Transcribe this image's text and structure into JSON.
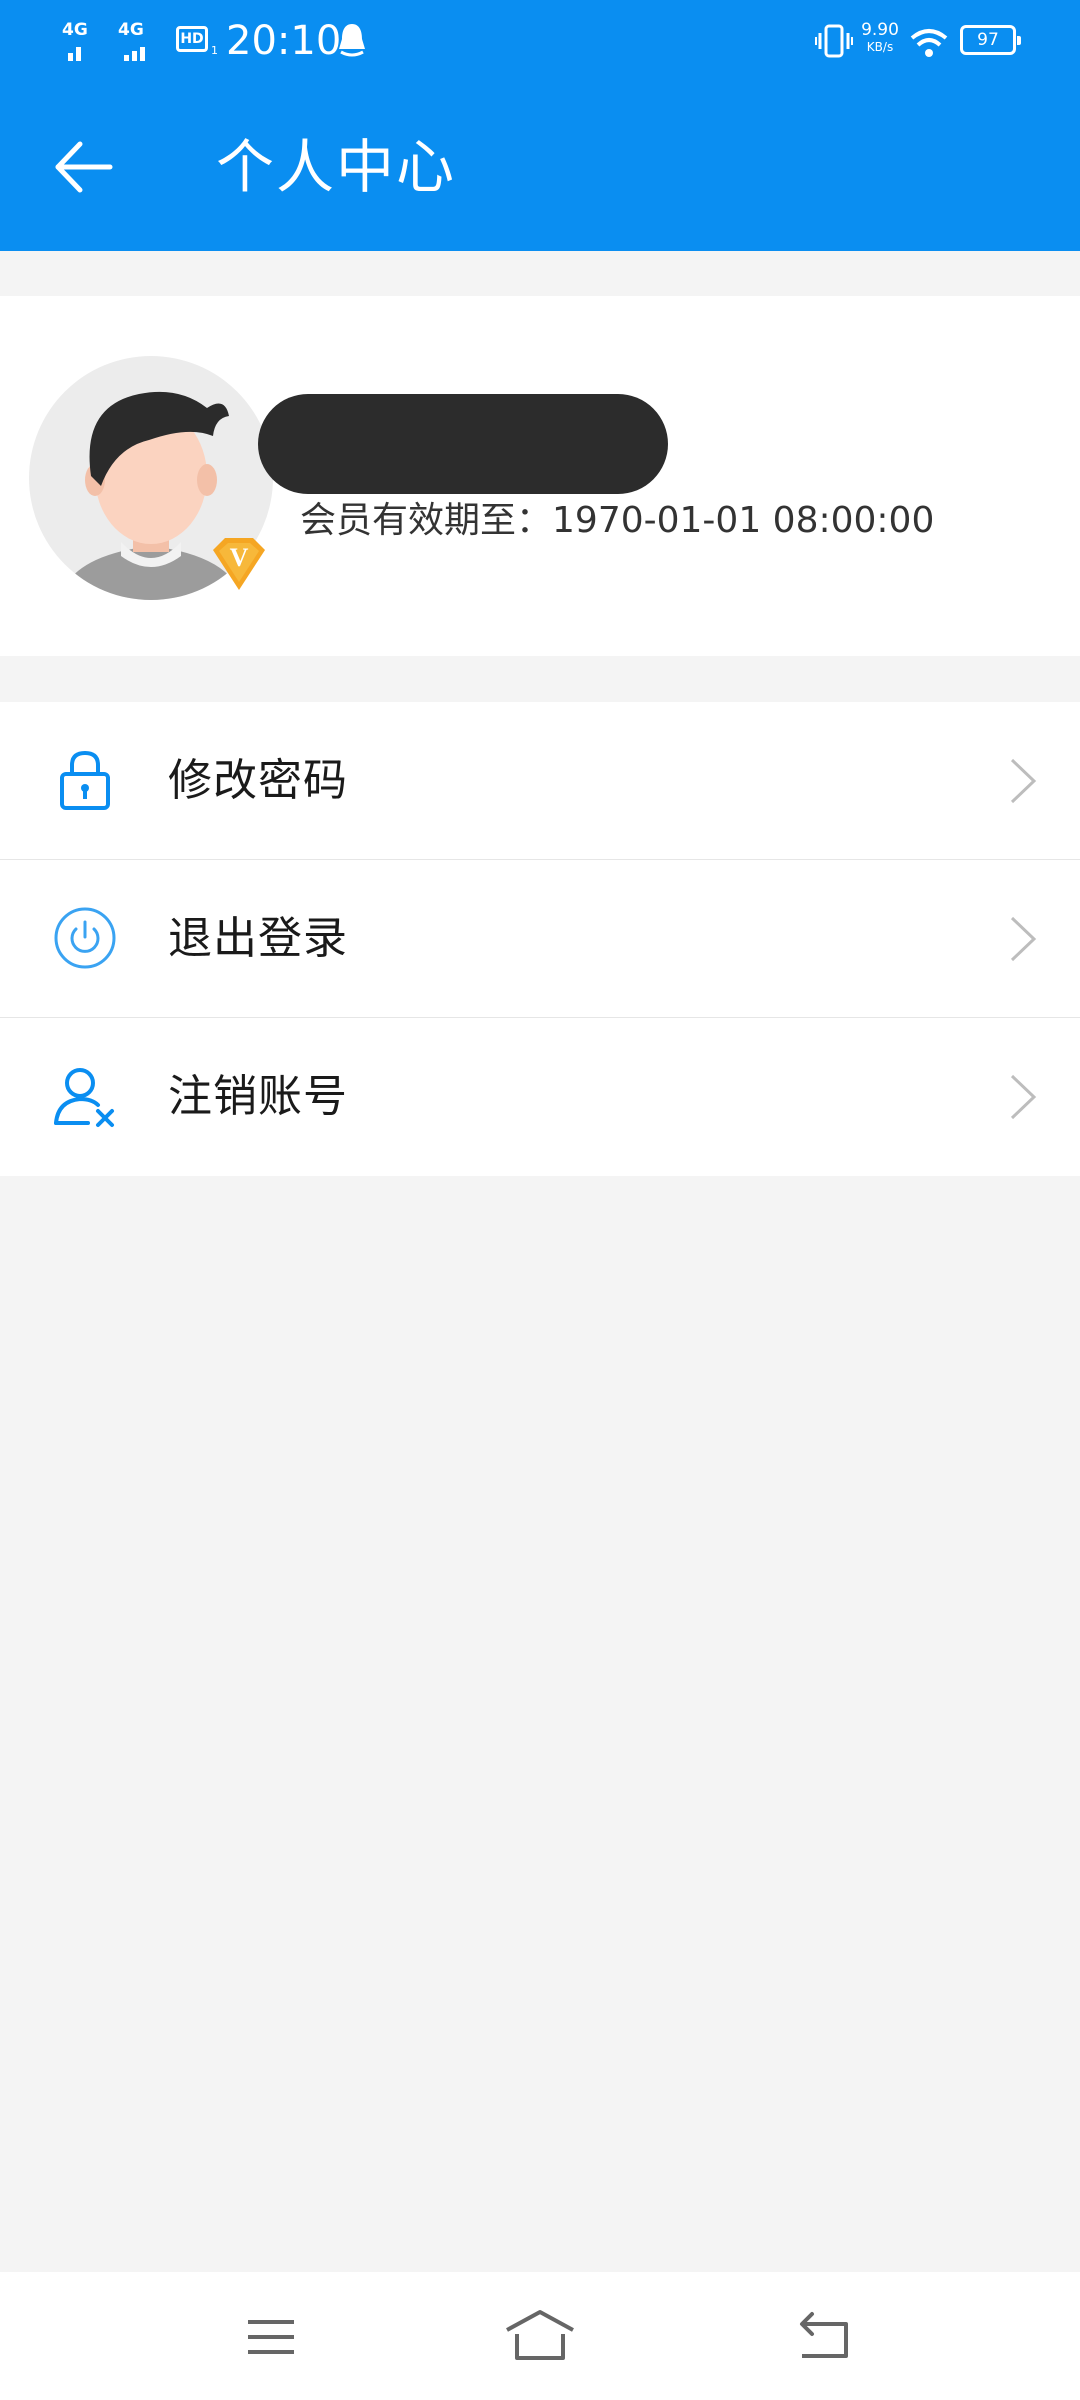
{
  "status_bar": {
    "signal1": "4G",
    "signal2": "4G",
    "hd": "HD",
    "hd_sub": "1",
    "time": "20:10",
    "net_speed_value": "9.90",
    "net_speed_unit": "KB/s",
    "battery": "97",
    "icons": [
      "qq-bell-icon",
      "vibrate-icon",
      "wifi-icon",
      "battery-icon"
    ]
  },
  "header": {
    "title": "个人中心",
    "back_icon": "arrow-left-icon"
  },
  "profile": {
    "member_expiry_label": "会员有效期至：",
    "member_expiry_value": "1970-01-01 08:00:00",
    "avatar_icon": "avatar-icon",
    "vip_badge": "V"
  },
  "menu": {
    "items": [
      {
        "label": "修改密码",
        "icon": "lock-icon"
      },
      {
        "label": "退出登录",
        "icon": "power-icon"
      },
      {
        "label": "注销账号",
        "icon": "user-remove-icon"
      }
    ]
  },
  "nav_bar": {
    "icons": [
      "menu-icon",
      "home-icon",
      "back-icon"
    ]
  },
  "colors": {
    "primary": "#0a8ef1",
    "background": "#f4f4f4",
    "vip_gold": "#f5a623"
  }
}
